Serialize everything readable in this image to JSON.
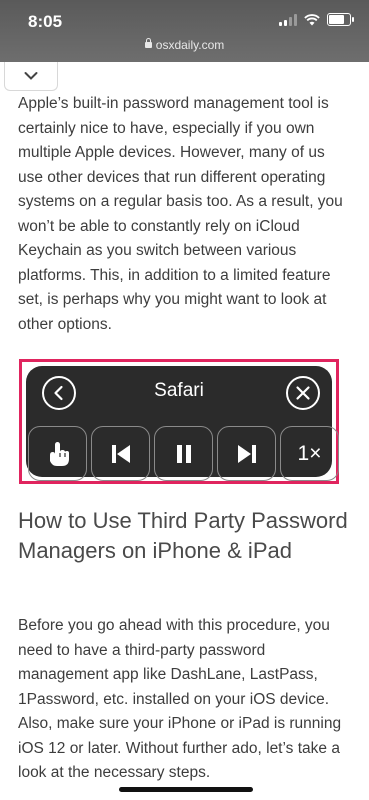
{
  "status_bar": {
    "time": "8:05"
  },
  "browser": {
    "url": "osxdaily.com"
  },
  "article": {
    "paragraph_1": "Apple’s built-in password management tool is certainly nice to have, especially if you own multiple Apple devices. However, many of us use other devices that run different operating systems on a regular basis too. As a result, you won’t be able to constantly rely on iCloud Keychain as you switch between various platforms. This, in addition to a limited feature set, is perhaps why you might want to look at other options.",
    "heading": "How to Use Third Party Password Managers on iPhone & iPad",
    "paragraph_2": "Before you go ahead with this procedure, you need to have a third-party password management app like DashLane, LastPass, 1Password, etc. installed on your iOS device. Also, make sure your iPhone or iPad is running iOS 12 or later. Without further ado, let’s take a look at the necessary steps."
  },
  "screenshot_panel": {
    "title": "Safari",
    "speed_label": "1×"
  },
  "colors": {
    "highlight_border": "#e0245e",
    "panel_bg": "#2b2b2b"
  },
  "icons": [
    "lock-icon",
    "chevron-down-icon",
    "back-arrow-icon",
    "close-icon",
    "hand-pointer-icon",
    "skip-back-icon",
    "pause-icon",
    "skip-forward-icon"
  ]
}
